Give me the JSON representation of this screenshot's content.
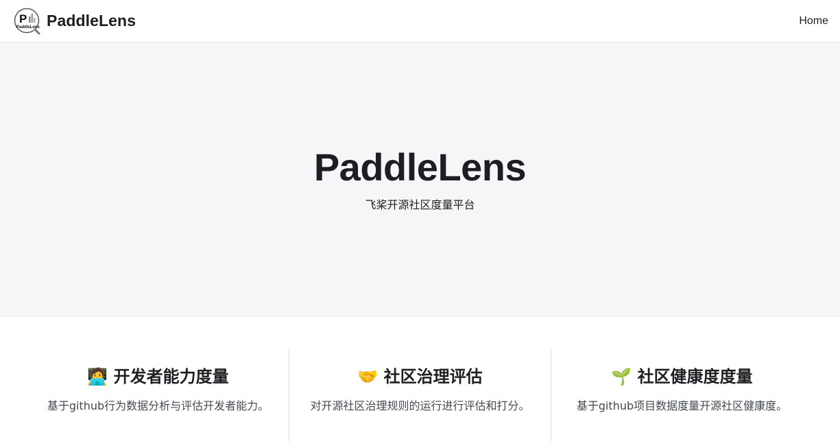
{
  "navbar": {
    "brand_title": "PaddleLens",
    "logo_icon": "paddlelens-logo-icon",
    "links": [
      {
        "label": "Home"
      }
    ]
  },
  "hero": {
    "title": "PaddleLens",
    "subtitle": "飞桨开源社区度量平台"
  },
  "features": [
    {
      "emoji": "🧑‍💻",
      "icon": "developer-emoji-icon",
      "title": "开发者能力度量",
      "description": "基于github行为数据分析与评估开发者能力。"
    },
    {
      "emoji": "🤝",
      "icon": "handshake-emoji-icon",
      "title": "社区治理评估",
      "description": "对开源社区治理规则的运行进行评估和打分。"
    },
    {
      "emoji": "🌱",
      "icon": "seedling-emoji-icon",
      "title": "社区健康度度量",
      "description": "基于github项目数据度量开源社区健康度。"
    }
  ]
}
